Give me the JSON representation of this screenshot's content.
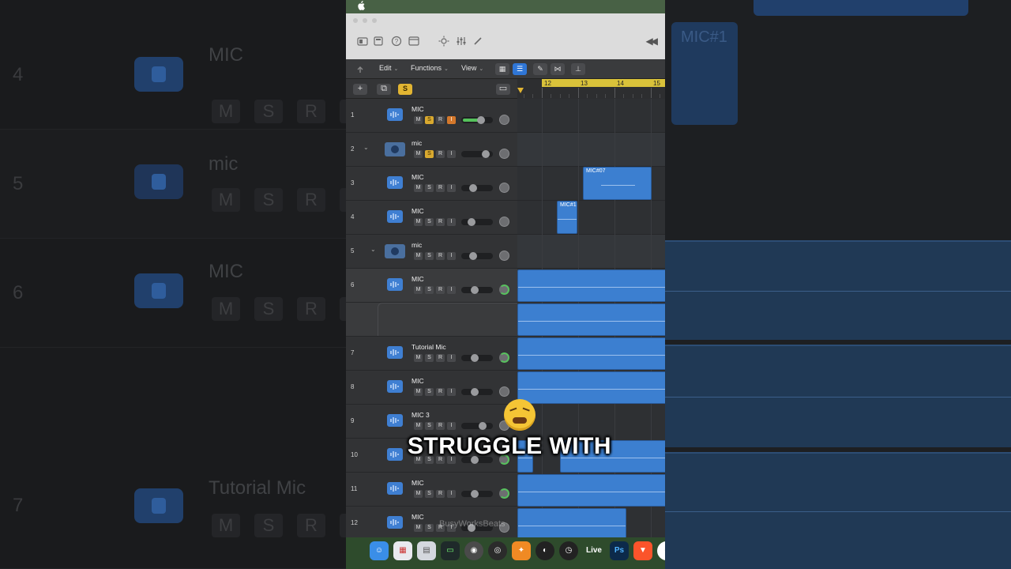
{
  "toolbar": {
    "edit": "Edit",
    "functions": "Functions",
    "view": "View"
  },
  "header": {
    "solo_label": "S"
  },
  "ruler": {
    "bars": [
      "12",
      "13",
      "14",
      "15"
    ]
  },
  "tracks": [
    {
      "num": "1",
      "name": "MIC"
    },
    {
      "num": "2",
      "name": "mic"
    },
    {
      "num": "3",
      "name": "MIC"
    },
    {
      "num": "4",
      "name": "MIC"
    },
    {
      "num": "5",
      "name": "mic"
    },
    {
      "num": "6",
      "name": "MIC"
    },
    {
      "num": "",
      "name": ""
    },
    {
      "num": "7",
      "name": "Tutorial Mic"
    },
    {
      "num": "8",
      "name": "MIC"
    },
    {
      "num": "9",
      "name": "MIC 3"
    },
    {
      "num": "10",
      "name": ""
    },
    {
      "num": "11",
      "name": "MIC"
    },
    {
      "num": "12",
      "name": "MIC"
    }
  ],
  "track_buttons": {
    "m": "M",
    "s": "S",
    "r": "R",
    "i": "I"
  },
  "regions": {
    "mic07": "MIC#07",
    "mic1": "MIC#1"
  },
  "background": {
    "left": [
      {
        "num": "4",
        "name": "MIC"
      },
      {
        "num": "5",
        "name": "mic"
      },
      {
        "num": "6",
        "name": "MIC"
      },
      {
        "num": "7",
        "name": "Tutorial Mic"
      }
    ],
    "right_region": "MIC#1"
  },
  "dock": {
    "live": "Live",
    "ps": "Ps"
  },
  "watermark": "BusyWorksBeats",
  "caption": "STRUGGLE WITH",
  "colors": {
    "region_blue": "#3c7fd0",
    "cycle_yellow": "#d9c23a",
    "solo_yellow": "#d9a92f",
    "input_orange": "#d4782b",
    "fader_green": "#55c25b"
  }
}
